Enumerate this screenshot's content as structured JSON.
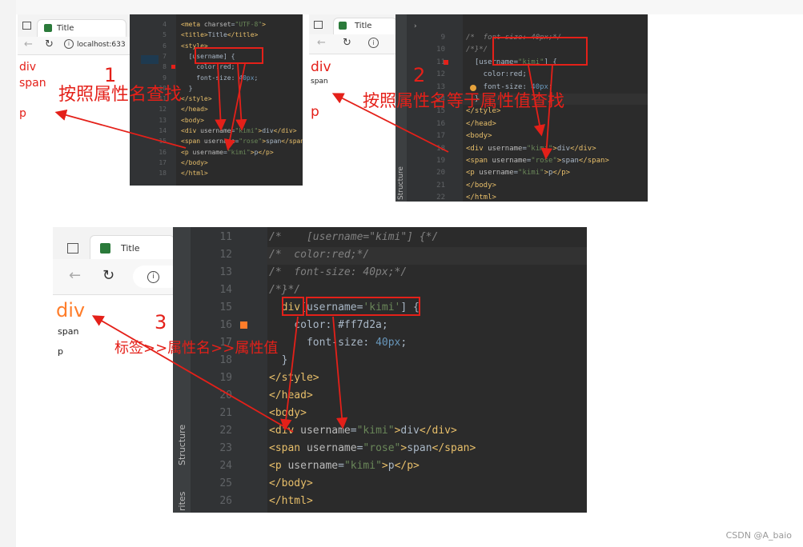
{
  "panel1": {
    "tab_title": "Title",
    "url": "localhost:633",
    "render": [
      "div",
      "span",
      "p"
    ],
    "number": "1",
    "caption": "按照属性名查找",
    "lines": [
      "4",
      "5",
      "6",
      "7",
      "8",
      "9",
      "10",
      "11",
      "12",
      "13",
      "14",
      "15",
      "16",
      "17",
      "18"
    ],
    "code": [
      "<meta charset=\"UTF-8\">",
      "<title>Title</title>",
      "<style>",
      "  [username] {",
      "    color:red;",
      "    font-size: 40px;",
      "  }",
      "</style>",
      "</head>",
      "<body>",
      "<div username=\"kimi\">div</div>",
      "<span username=\"rose\">span</span>",
      "<p username=\"kimi\">p</p>",
      "</body>",
      "</html>"
    ]
  },
  "panel2": {
    "tab_title": "Title",
    "render": [
      "div",
      "span",
      "p"
    ],
    "number": "2",
    "caption": "按照属性名等于属性值查找",
    "lines": [
      "9",
      "10",
      "11",
      "12",
      "13",
      "14",
      "15",
      "16",
      "17",
      "18",
      "19",
      "20",
      "21",
      "22"
    ],
    "code": [
      "/*  font-size: 40px;*/",
      "/*}*/",
      "  [username=\"kimi\"] {",
      "    color:red;",
      "    font-size: 40px;",
      "  }",
      "</style>",
      "</head>",
      "<body>",
      "<div username=\"kimi\">div</div>",
      "<span username=\"rose\">span</span>",
      "<p username=\"kimi\">p</p>",
      "</body>",
      "</html>"
    ],
    "structure_label": "Structure"
  },
  "panel3": {
    "tab_title": "Title",
    "render": [
      "div",
      "span",
      "p"
    ],
    "number": "3",
    "caption": "标签>>属性名>>属性值",
    "lines": [
      "11",
      "12",
      "13",
      "14",
      "15",
      "16",
      "17",
      "18",
      "19",
      "20",
      "21",
      "22",
      "23",
      "24",
      "25",
      "26"
    ],
    "code": [
      "/*    [username=\"kimi\"] {*/",
      "/*  color:red;*/",
      "/*  font-size: 40px;*/",
      "/*}*/",
      "  div[username='kimi'] {",
      "    color: #ff7d2a;",
      "      font-size: 40px;",
      "  }",
      "</style>",
      "</head>",
      "<body>",
      "<div username=\"kimi\">div</div>",
      "<span username=\"rose\">span</span>",
      "<p username=\"kimi\">p</p>",
      "</body>",
      "</html>"
    ],
    "structure_label": "Structure",
    "favorites_label": "rites"
  },
  "watermark": "CSDN @A_baio",
  "colors": {
    "annotation": "#e42019",
    "div_orange": "#ff7d2a",
    "ide_bg": "#2b2b2b"
  }
}
